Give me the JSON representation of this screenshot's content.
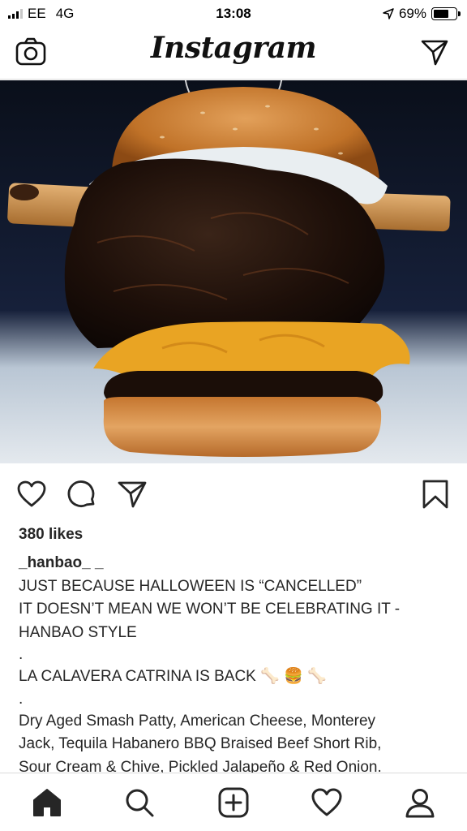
{
  "status_bar": {
    "carrier": "EE",
    "network": "4G",
    "time": "13:08",
    "battery": "69%",
    "battery_level": 0.69
  },
  "header": {
    "logo": "Instagram"
  },
  "post": {
    "likes": "380 likes",
    "username": "_hanbao_ _",
    "caption_lines": [
      "JUST BECAUSE HALLOWEEN IS “CANCELLED”",
      "IT DOESN’T MEAN WE WON’T BE CELEBRATING IT -",
      "HANBAO STYLE",
      ".",
      "LA CALAVERA CATRINA IS BACK 🦴 🍔 🦴",
      ".",
      "Dry Aged Smash Patty, American Cheese, Monterey",
      "Jack, Tequila Habanero BBQ Braised Beef Short Rib,",
      "Sour Cream & Chive, Pickled Jalapeño & Red Onion."
    ]
  },
  "icons": {
    "camera": "camera-icon",
    "direct": "direct-message-icon",
    "like": "heart-icon",
    "comment": "comment-icon",
    "share": "share-icon",
    "save": "bookmark-icon",
    "home": "home-icon",
    "search": "search-icon",
    "new_post": "new-post-icon",
    "activity": "activity-heart-icon",
    "profile": "profile-icon"
  },
  "colors": {
    "text": "#262626",
    "divider": "#dbdbdb",
    "bun": "#c97a2e",
    "cheese": "#e9a423",
    "photo_background": "#0d1320"
  }
}
